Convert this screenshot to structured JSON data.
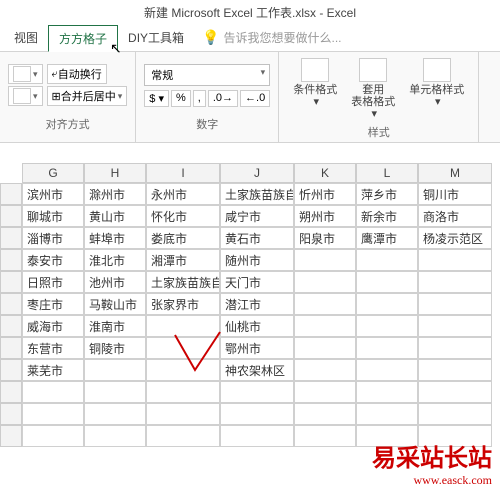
{
  "title": "新建 Microsoft Excel 工作表.xlsx - Excel",
  "tabs": {
    "view": "视图",
    "fangfang": "方方格子",
    "diy": "DIY工具箱",
    "tellme": "告诉我您想要做什么..."
  },
  "ribbon": {
    "align_group": "对齐方式",
    "wrap": "自动换行",
    "merge": "合并后居中",
    "number_group": "数字",
    "general": "常规",
    "styles_group": "样式",
    "cond_fmt": "条件格式",
    "tbl_fmt_l1": "套用",
    "tbl_fmt_l2": "表格格式",
    "cell_style": "单元格样式"
  },
  "cols": [
    "G",
    "H",
    "I",
    "J",
    "K",
    "L",
    "M"
  ],
  "grid": [
    [
      "滨州市",
      "滁州市",
      "永州市",
      "土家族苗族自",
      "忻州市",
      "萍乡市",
      "铜川市"
    ],
    [
      "聊城市",
      "黄山市",
      "怀化市",
      "咸宁市",
      "朔州市",
      "新余市",
      "商洛市"
    ],
    [
      "淄博市",
      "蚌埠市",
      "娄底市",
      "黄石市",
      "阳泉市",
      "鹰潭市",
      "杨凌示范区"
    ],
    [
      "泰安市",
      "淮北市",
      "湘潭市",
      "随州市",
      "",
      "",
      ""
    ],
    [
      "日照市",
      "池州市",
      "土家族苗族自",
      "天门市",
      "",
      "",
      ""
    ],
    [
      "枣庄市",
      "马鞍山市",
      "张家界市",
      "潜江市",
      "",
      "",
      ""
    ],
    [
      "威海市",
      "淮南市",
      "",
      "仙桃市",
      "",
      "",
      ""
    ],
    [
      "东营市",
      "铜陵市",
      "",
      "鄂州市",
      "",
      "",
      ""
    ],
    [
      "莱芜市",
      "",
      "",
      "神农架林区",
      "",
      "",
      ""
    ],
    [
      "",
      "",
      "",
      "",
      "",
      "",
      ""
    ],
    [
      "",
      "",
      "",
      "",
      "",
      "",
      ""
    ],
    [
      "",
      "",
      "",
      "",
      "",
      "",
      ""
    ]
  ],
  "watermark": {
    "cn": "易采站长站",
    "en": "www.easck.com"
  }
}
